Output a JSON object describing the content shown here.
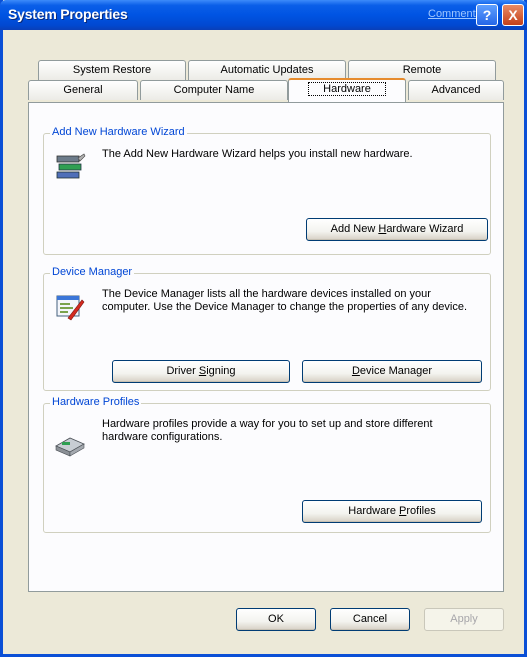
{
  "window": {
    "title": "System Properties",
    "comments_link": "Comments?",
    "help_button": "?",
    "close_button": "X"
  },
  "tabs": {
    "row1": [
      "System Restore",
      "Automatic Updates",
      "Remote"
    ],
    "row2": [
      "General",
      "Computer Name",
      "Hardware",
      "Advanced"
    ],
    "active": "Hardware"
  },
  "groups": {
    "wizard": {
      "title": "Add New Hardware Wizard",
      "description": "The Add New Hardware Wizard helps you install new hardware.",
      "button_prefix": "Add New ",
      "button_mnemonic": "H",
      "button_suffix": "ardware Wizard",
      "icon": "hardware-wizard-icon"
    },
    "device_manager": {
      "title": "Device Manager",
      "description": "The Device Manager lists all the hardware devices installed on your computer. Use the Device Manager to change the properties of any device.",
      "driver_signing_prefix": "Driver ",
      "driver_signing_mnemonic": "S",
      "driver_signing_suffix": "igning",
      "device_manager_mnemonic": "D",
      "device_manager_suffix": "evice Manager",
      "icon": "device-manager-icon"
    },
    "profiles": {
      "title": "Hardware Profiles",
      "description": "Hardware profiles provide a way for you to set up and store different hardware configurations.",
      "button_prefix": "Hardware ",
      "button_mnemonic": "P",
      "button_suffix": "rofiles",
      "icon": "hardware-profiles-icon"
    }
  },
  "footer": {
    "ok": "OK",
    "cancel": "Cancel",
    "apply": "Apply"
  }
}
